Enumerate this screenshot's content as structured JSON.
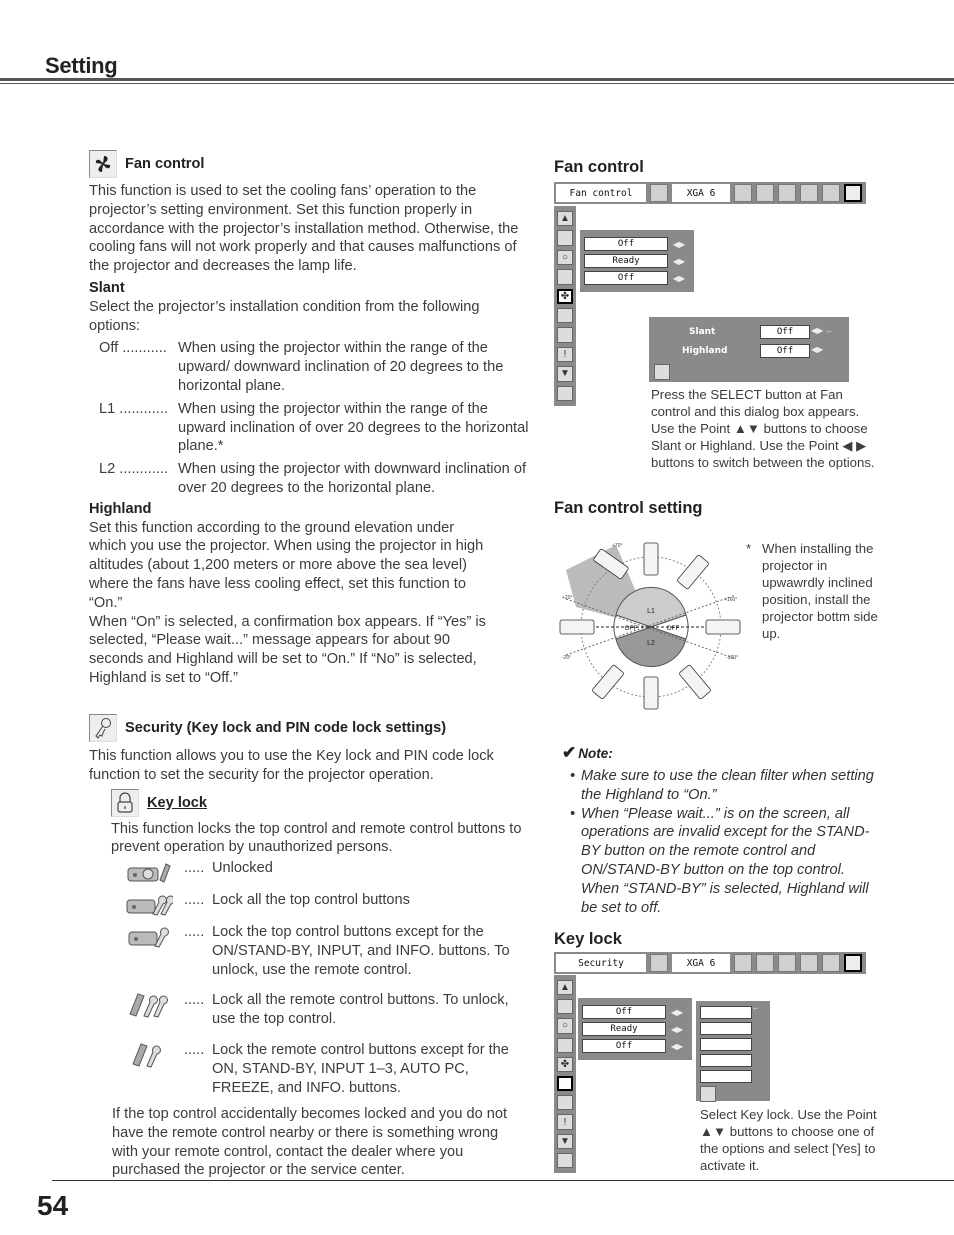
{
  "header": {
    "title": "Setting"
  },
  "left": {
    "fan_control": {
      "icon": "fan-icon",
      "title": "Fan control",
      "intro": "This function is used to set the cooling fans’ operation to the projector’s setting environment. Set this function properly in accordance with the projector’s installation method. Otherwise, the cooling fans will not work properly and that causes malfunctions of the projector and decreases the lamp life.",
      "slant": {
        "heading": "Slant",
        "intro": "Select the projector’s installation condition from the following options:",
        "options": [
          {
            "key": "Off ...........",
            "desc": "When using the projector within the range of the upward/ downward inclination of 20 degrees to the horizontal plane."
          },
          {
            "key": "L1 ............",
            "desc": "When using the projector within the range of the upward inclination of over 20 degrees to the horizontal plane.*"
          },
          {
            "key": "L2 ............",
            "desc": "When using the projector with downward inclination of over 20 degrees to the horizontal plane."
          }
        ]
      },
      "highland": {
        "heading": "Highland",
        "text1": "Set this function according to the ground elevation under which you use the projector. When using the projector in high altitudes (about 1,200 meters or more above the sea level) where the fans have less cooling effect, set this function to “On.”",
        "text2": "When “On” is selected, a confirmation box appears. If “Yes” is selected, “Please wait...” message appears for about 90 seconds and Highland will be set to “On.” If “No” is selected, Highland is set to “Off.”"
      }
    },
    "security": {
      "icon": "key-icon",
      "title": "Security (Key lock and PIN code lock settings)",
      "intro": "This function allows you to use the Key lock and PIN code lock function to set the security for the projector operation.",
      "key_lock": {
        "icon": "padlock-icon",
        "title": "Key lock",
        "intro": "This function locks the top control and remote control buttons to prevent operation by unauthorized persons.",
        "options": [
          {
            "icon": "projector-unlocked-icon",
            "dots": ".....",
            "desc": "Unlocked"
          },
          {
            "icon": "projector-double-key-icon",
            "dots": ".....",
            "desc": "Lock all the top control buttons"
          },
          {
            "icon": "projector-single-key-icon",
            "dots": ".....",
            "desc": "Lock the top control buttons except for the ON/STAND-BY, INPUT, and INFO. buttons. To unlock, use the remote control."
          },
          {
            "icon": "remote-double-key-icon",
            "dots": ".....",
            "desc": "Lock all the remote control buttons. To unlock, use the top control."
          },
          {
            "icon": "remote-single-key-icon",
            "dots": ".....",
            "desc": "Lock the remote control buttons except for the ON, STAND-BY, INPUT 1–3, AUTO PC, FREEZE, and INFO. buttons."
          }
        ],
        "footer": "If the top control accidentally becomes locked and you do not have the remote control nearby or there is something wrong with your remote control, contact the dealer where you purchased the projector or the service center."
      }
    }
  },
  "right": {
    "fan_control_fig": {
      "heading": "Fan control",
      "menu_title": "Fan control",
      "signal": "XGA 6",
      "fields": [
        "Off",
        "Ready",
        "Off"
      ],
      "dialog": {
        "rows": [
          {
            "label": "Slant",
            "value": "Off"
          },
          {
            "label": "Highland",
            "value": "Off"
          }
        ]
      },
      "caption": "Press the SELECT button at Fan control and this dialog box appears. Use the Point ▲▼ buttons to choose Slant or Highland. Use the Point ◀ ▶ buttons to switch between the options."
    },
    "fan_setting_fig": {
      "heading": "Fan control setting",
      "angles": [
        "+70°",
        "+20°",
        "-20°",
        "+160°",
        "-160°"
      ],
      "zones": [
        "L1",
        "L2",
        "OFF",
        "OFF"
      ],
      "footnote_mark": "*",
      "footnote": "When installing the projector in upwawrdly inclined position, install the projector bottm side up."
    },
    "note": {
      "title": "Note:",
      "items": [
        "Make sure to use the clean filter when setting the Highland to “On.”",
        "When “Please wait...” is on the screen, all operations are invalid except for the STAND-BY button on the remote control and ON/STAND-BY button on the top control. When “STAND-BY” is selected, Highland will be set to off."
      ]
    },
    "key_lock_fig": {
      "heading": "Key lock",
      "menu_title": "Security",
      "signal": "XGA 6",
      "fields": [
        "Off",
        "Ready",
        "Off"
      ],
      "caption": "Select Key lock. Use the Point ▲▼ buttons to choose one of the options and select [Yes] to activate it."
    }
  },
  "footer": {
    "page_number": "54"
  }
}
